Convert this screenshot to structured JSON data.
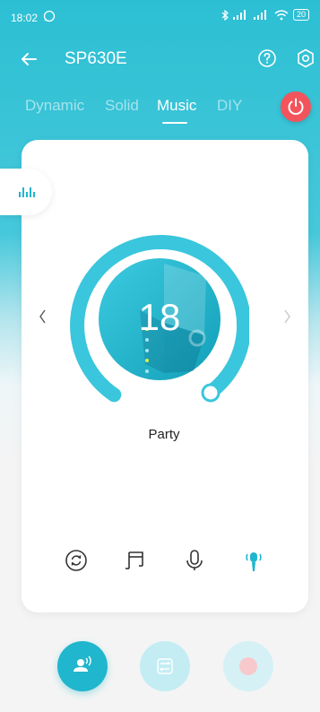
{
  "status": {
    "time": "18:02",
    "battery": "20"
  },
  "header": {
    "title": "SP630E"
  },
  "tabs": [
    {
      "label": "Dynamic",
      "active": false
    },
    {
      "label": "Solid",
      "active": false
    },
    {
      "label": "Music",
      "active": true
    },
    {
      "label": "DIY",
      "active": false
    }
  ],
  "music": {
    "value": "18",
    "mode_name": "Party"
  },
  "sources": [
    "sync-icon",
    "music-note-icon",
    "microphone-icon",
    "phone-speaker-icon"
  ],
  "colors": {
    "accent": "#20b6cd",
    "power": "#f2545b",
    "header": "#2cbfd3"
  }
}
